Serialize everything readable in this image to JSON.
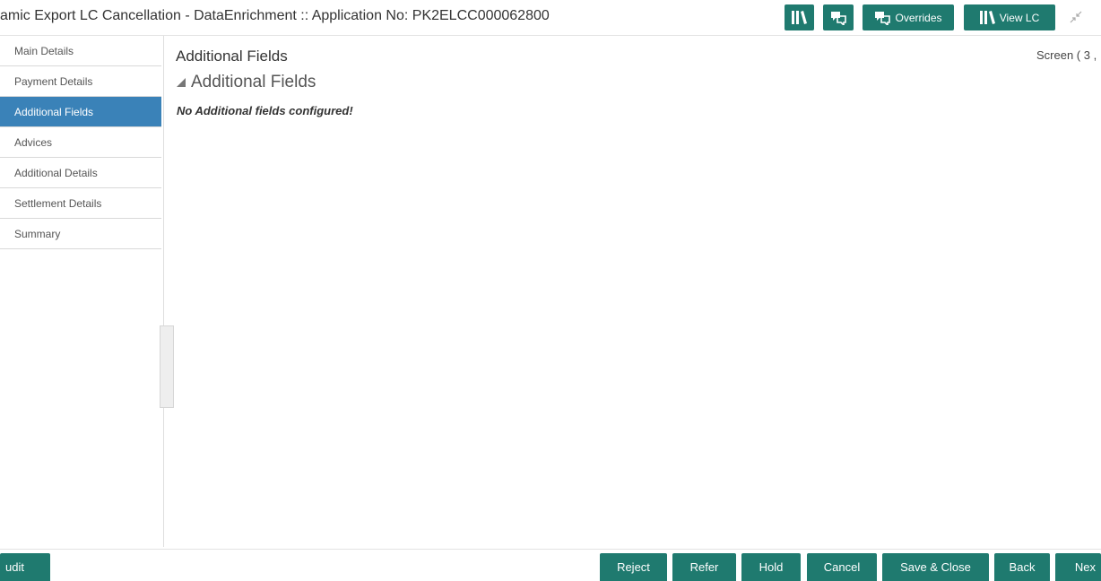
{
  "header": {
    "title": "amic Export LC Cancellation - DataEnrichment :: Application No: PK2ELCC000062800",
    "buttons": [
      {
        "icon": "library-icon",
        "label": ""
      },
      {
        "icon": "chat-icon",
        "label": ""
      },
      {
        "icon": "chat-icon",
        "label": "Overrides"
      },
      {
        "icon": "library-icon",
        "label": "View LC"
      }
    ]
  },
  "sidebar": {
    "items": [
      {
        "label": "Main Details"
      },
      {
        "label": "Payment Details"
      },
      {
        "label": "Additional Fields",
        "active": true
      },
      {
        "label": "Advices"
      },
      {
        "label": "Additional Details"
      },
      {
        "label": "Settlement Details"
      },
      {
        "label": "Summary"
      }
    ]
  },
  "main": {
    "title": "Additional Fields",
    "screen_indicator": "Screen ( 3 ,",
    "section_title": "Additional Fields",
    "message": "No Additional fields configured!"
  },
  "footer": {
    "audit": "udit",
    "reject": "Reject",
    "refer": "Refer",
    "hold": "Hold",
    "cancel": "Cancel",
    "save_close": "Save & Close",
    "back": "Back",
    "next": "Nex"
  },
  "colors": {
    "accent": "#1f7a6f",
    "active_nav": "#3a82b8"
  }
}
